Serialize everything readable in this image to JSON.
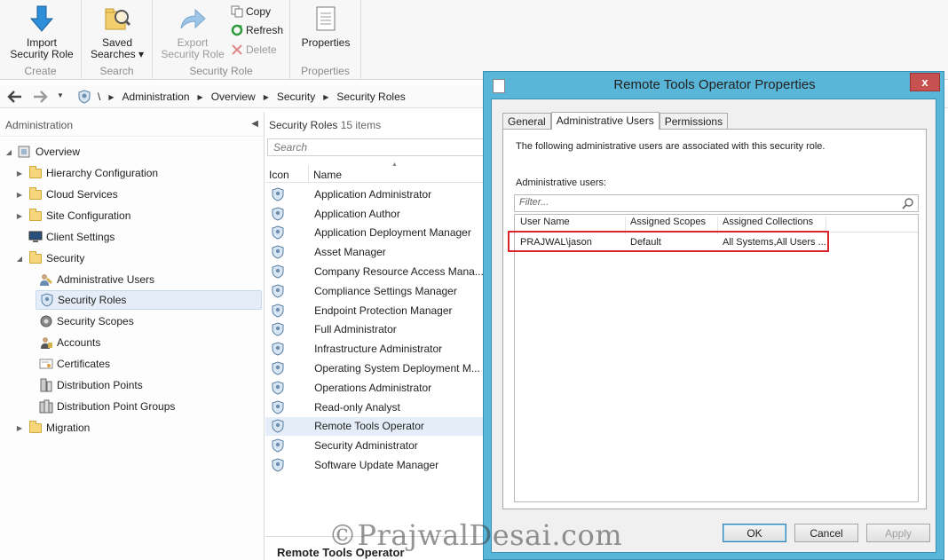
{
  "ribbon": {
    "import_role": "Import\nSecurity Role",
    "saved_searches": "Saved\nSearches ▾",
    "export_role": "Export\nSecurity Role",
    "copy": "Copy",
    "refresh": "Refresh",
    "delete": "Delete",
    "properties": "Properties",
    "groups": {
      "create": "Create",
      "search": "Search",
      "security_role": "Security Role",
      "properties": "Properties"
    }
  },
  "breadcrumb": [
    "\\",
    "Administration",
    "Overview",
    "Security",
    "Security Roles"
  ],
  "left_pane": {
    "header": "Administration",
    "items": [
      {
        "label": "Overview"
      },
      {
        "label": "Hierarchy Configuration"
      },
      {
        "label": "Cloud Services"
      },
      {
        "label": "Site Configuration"
      },
      {
        "label": "Client Settings"
      },
      {
        "label": "Security"
      },
      {
        "label": "Administrative Users"
      },
      {
        "label": "Security Roles"
      },
      {
        "label": "Security Scopes"
      },
      {
        "label": "Accounts"
      },
      {
        "label": "Certificates"
      },
      {
        "label": "Distribution Points"
      },
      {
        "label": "Distribution Point Groups"
      },
      {
        "label": "Migration"
      }
    ]
  },
  "list": {
    "title": "Security Roles",
    "count": "15 items",
    "search_placeholder": "Search",
    "col_icon": "Icon",
    "col_name": "Name",
    "rows": [
      "Application Administrator",
      "Application Author",
      "Application Deployment Manager",
      "Asset Manager",
      "Company Resource Access Mana...",
      "Compliance Settings Manager",
      "Endpoint Protection Manager",
      "Full Administrator",
      "Infrastructure Administrator",
      "Operating System Deployment M...",
      "Operations Administrator",
      "Read-only Analyst",
      "Remote Tools Operator",
      "Security Administrator",
      "Software Update Manager"
    ],
    "selected_index": 12,
    "detail_title": "Remote Tools Operator"
  },
  "dialog": {
    "title": "Remote Tools Operator Properties",
    "close": "x",
    "tabs": [
      "General",
      "Administrative Users",
      "Permissions"
    ],
    "active_tab": 1,
    "description": "The following administrative users are associated with this security role.",
    "users_label": "Administrative users:",
    "filter_placeholder": "Filter...",
    "columns": [
      "User Name",
      "Assigned Scopes",
      "Assigned Collections"
    ],
    "rows": [
      {
        "user": "PRAJWAL\\jason",
        "scopes": "Default",
        "collections": "All Systems,All Users ..."
      }
    ],
    "buttons": {
      "ok": "OK",
      "cancel": "Cancel",
      "apply": "Apply"
    }
  },
  "watermark": "©PrajwalDesai.com",
  "colors": {
    "dialog_frame": "#59b6d8",
    "highlight": "#d9252b",
    "selection": "#e5eef8"
  }
}
